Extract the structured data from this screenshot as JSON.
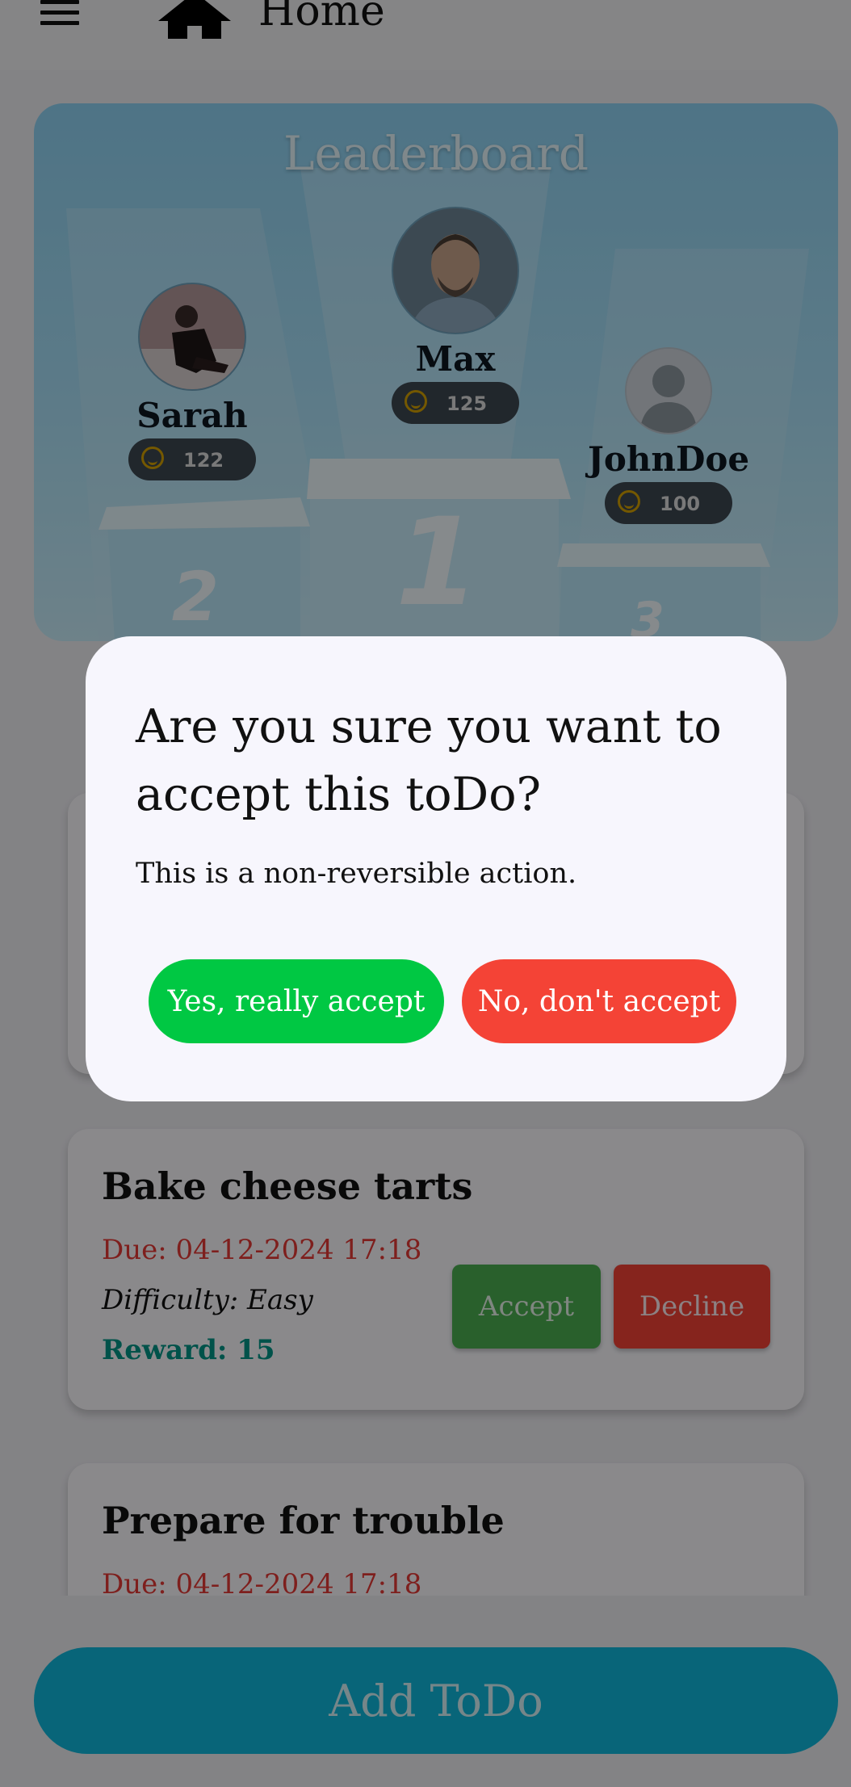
{
  "appbar": {
    "title": "Home",
    "menu_icon": "menu-icon",
    "home_icon": "home-icon"
  },
  "leaderboard": {
    "title": "Leaderboard",
    "players": [
      {
        "name": "Max",
        "score": "125",
        "rank": "1"
      },
      {
        "name": "Sarah",
        "score": "122",
        "rank": "2"
      },
      {
        "name": "JohnDoe",
        "score": "100",
        "rank": "3"
      }
    ]
  },
  "todos": [
    {
      "title": "Bake cheese tarts",
      "due": "Due: 04-12-2024 17:18",
      "difficulty": "Difficulty: Easy",
      "reward": "Reward: 15",
      "accept_label": "Accept",
      "decline_label": "Decline"
    },
    {
      "title": "Prepare for trouble",
      "due": "Due: 04-12-2024 17:18"
    }
  ],
  "add_button": {
    "label": "Add ToDo"
  },
  "dialog": {
    "title": "Are you sure you want to accept this toDo?",
    "text": "This is a non-reversible action.",
    "confirm_label": "Yes, really accept",
    "cancel_label": "No, don't accept"
  },
  "colors": {
    "accent": "#10b9dc",
    "accept": "#4caf50",
    "decline": "#f44336",
    "confirm": "#00c843",
    "due": "#e53935",
    "reward": "#009688"
  }
}
